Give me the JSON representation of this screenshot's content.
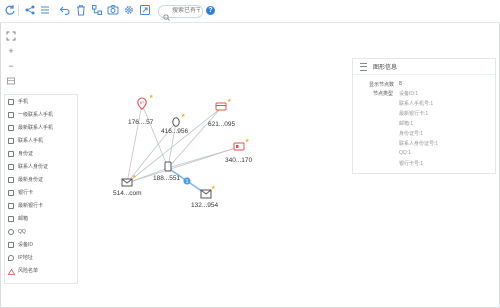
{
  "toolbar": {
    "search_placeholder": "搜索已有节点",
    "help_label": "?"
  },
  "zoom": {
    "plus": "+",
    "minus": "−"
  },
  "legend": {
    "items": [
      {
        "label": "手机",
        "icon": "phone-icon"
      },
      {
        "label": "一级联系人手机",
        "icon": "phone-icon"
      },
      {
        "label": "最新联系人手机",
        "icon": "phone-icon"
      },
      {
        "label": "联系人手机",
        "icon": "phone-icon"
      },
      {
        "label": "身份证",
        "icon": "id-card-icon"
      },
      {
        "label": "联系人身份证",
        "icon": "id-card-icon"
      },
      {
        "label": "最新身份证",
        "icon": "id-card-icon"
      },
      {
        "label": "银行卡",
        "icon": "bank-card-icon"
      },
      {
        "label": "最新银行卡",
        "icon": "bank-card-icon"
      },
      {
        "label": "邮箱",
        "icon": "email-icon"
      },
      {
        "label": "QQ",
        "icon": "qq-icon"
      },
      {
        "label": "设备ID",
        "icon": "device-icon"
      },
      {
        "label": "IP地址",
        "icon": "ip-icon"
      },
      {
        "label": "风险名单",
        "icon": "warning-icon"
      }
    ]
  },
  "panel": {
    "title": "图形信息",
    "node_count_label": "显示节点数",
    "node_count_value": "8",
    "node_type_label": "节点类型",
    "node_types": [
      "设备ID:1",
      "联系人手机号:1",
      "最新银行卡:1",
      "邮箱:1",
      "身份证号:1",
      "联系人身份证号:1",
      "QQ:1",
      "银行卡号:1"
    ]
  },
  "graph": {
    "nodes": [
      {
        "label": "176....57",
        "type": "ip-address"
      },
      {
        "label": "416...956",
        "type": "qq"
      },
      {
        "label": "621...095",
        "type": "bank-card"
      },
      {
        "label": "340...170",
        "type": "id-card"
      },
      {
        "label": "188...551",
        "type": "phone"
      },
      {
        "label": "514...com",
        "type": "email"
      },
      {
        "label": "132...954",
        "type": "phone"
      }
    ],
    "edge_badge": "1"
  },
  "colors": {
    "accent": "#2f7fd0",
    "risk_star": "#f5a623",
    "icon_red": "#d9534f"
  }
}
